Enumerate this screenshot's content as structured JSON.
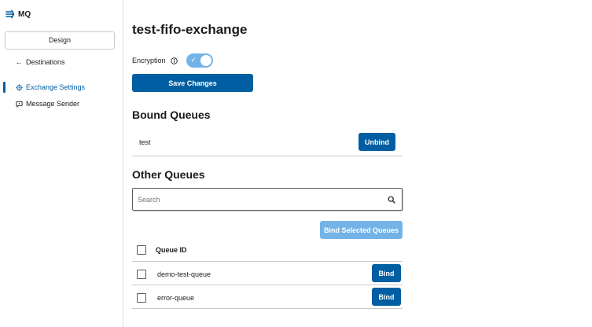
{
  "brand": {
    "name": "MQ",
    "icon": "mq-logo-icon"
  },
  "sidebar": {
    "design_label": "Design",
    "items": [
      {
        "label": "Destinations",
        "icon": "arrow-left-icon"
      },
      {
        "label": "Exchange Settings",
        "icon": "gear-icon",
        "active": true
      },
      {
        "label": "Message Sender",
        "icon": "message-icon"
      }
    ]
  },
  "page": {
    "title": "test-fifo-exchange",
    "encryption_label": "Encryption",
    "encryption_enabled": true,
    "save_label": "Save Changes"
  },
  "bound": {
    "title": "Bound Queues",
    "queues": [
      {
        "name": "test",
        "action": "Unbind"
      }
    ]
  },
  "other": {
    "title": "Other Queues",
    "search_placeholder": "Search",
    "bind_selected_label": "Bind Selected Queues",
    "column_header": "Queue ID",
    "queues": [
      {
        "name": "demo-test-queue",
        "action": "Bind"
      },
      {
        "name": "error-queue",
        "action": "Bind"
      }
    ]
  },
  "colors": {
    "primary": "#005ea2",
    "primary_disabled": "#73b3e7",
    "border": "#c9c9c9"
  }
}
